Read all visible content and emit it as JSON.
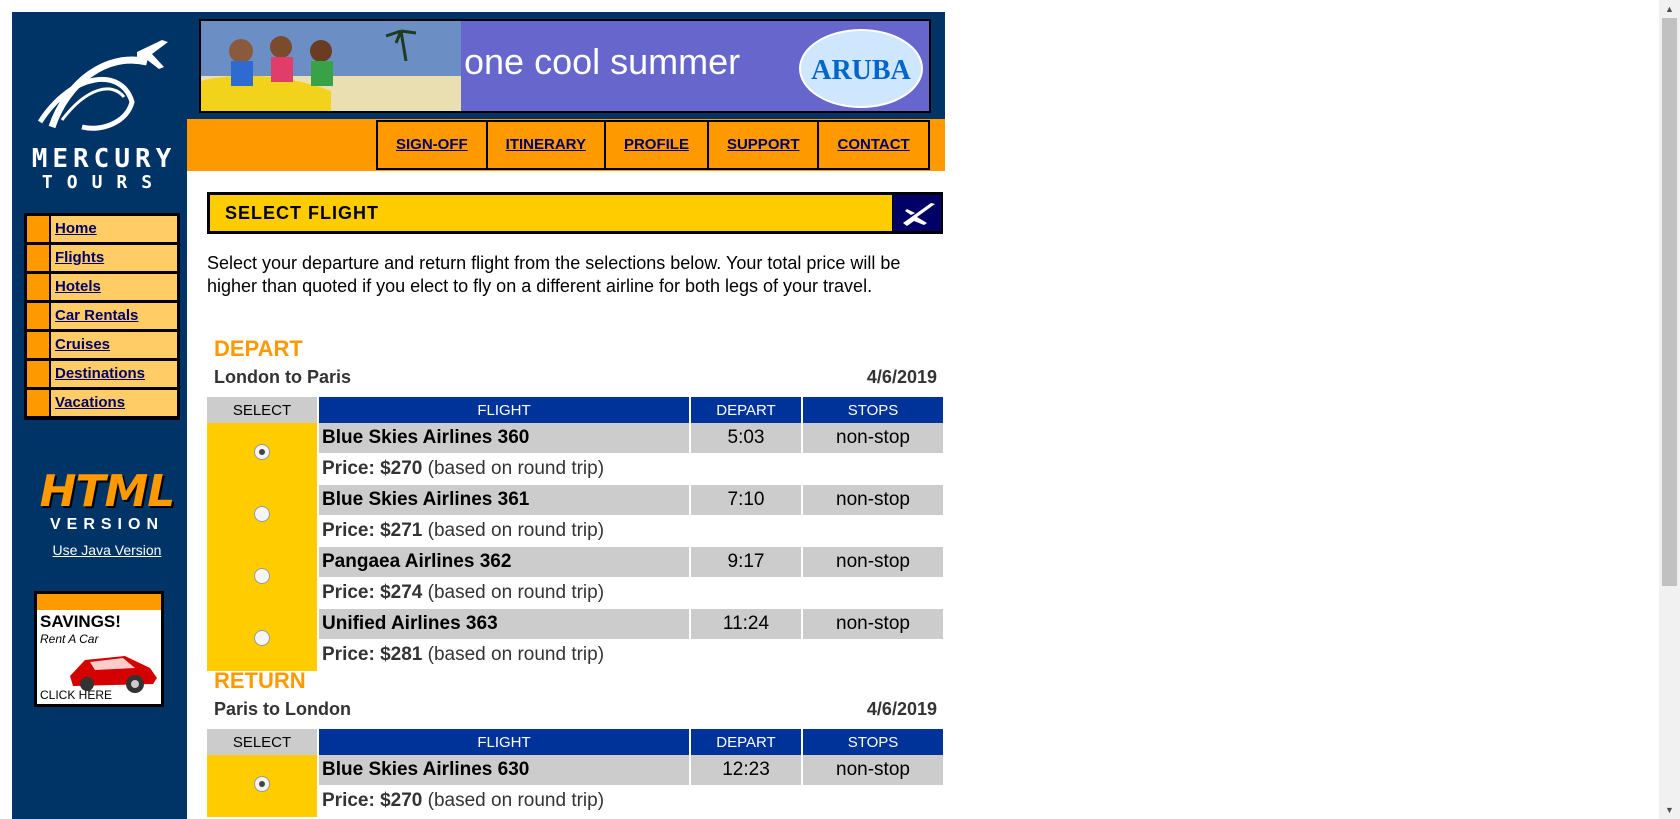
{
  "brand": {
    "line1": "MERCURY",
    "line2": "TOURS"
  },
  "sidebar": {
    "items": [
      {
        "label": "Home"
      },
      {
        "label": "Flights"
      },
      {
        "label": "Hotels"
      },
      {
        "label": "Car Rentals"
      },
      {
        "label": "Cruises"
      },
      {
        "label": "Destinations"
      },
      {
        "label": "Vacations"
      }
    ],
    "html_version": {
      "big": "HTML",
      "sub": "VERSION",
      "java_link": "Use Java Version"
    },
    "savings_ad": {
      "title": "SAVINGS!",
      "sub": "Rent A Car",
      "cta": "CLICK HERE"
    }
  },
  "banner": {
    "text": "one cool summer",
    "badge": "ARUBA"
  },
  "topnav": {
    "items": [
      {
        "label": "SIGN-OFF"
      },
      {
        "label": "ITINERARY"
      },
      {
        "label": "PROFILE"
      },
      {
        "label": "SUPPORT"
      },
      {
        "label": "CONTACT"
      }
    ]
  },
  "page_title": "SELECT FLIGHT",
  "intro": "Select your departure and return flight from the selections below. Your total price will be higher than quoted if you elect to fly on a different airline for both legs of your travel.",
  "table_headers": {
    "select": "SELECT",
    "flight": "FLIGHT",
    "depart": "DEPART",
    "stops": "STOPS"
  },
  "price_label": "Price:",
  "price_note": "(based on round trip)",
  "depart": {
    "heading": "DEPART",
    "route": "London to Paris",
    "date": "4/6/2019",
    "flights": [
      {
        "name": "Blue Skies Airlines 360",
        "time": "5:03",
        "stops": "non-stop",
        "price": "$270",
        "selected": true
      },
      {
        "name": "Blue Skies Airlines 361",
        "time": "7:10",
        "stops": "non-stop",
        "price": "$271",
        "selected": false
      },
      {
        "name": "Pangaea Airlines 362",
        "time": "9:17",
        "stops": "non-stop",
        "price": "$274",
        "selected": false
      },
      {
        "name": "Unified Airlines 363",
        "time": "11:24",
        "stops": "non-stop",
        "price": "$281",
        "selected": false
      }
    ]
  },
  "return": {
    "heading": "RETURN",
    "route": "Paris to London",
    "date": "4/6/2019",
    "flights": [
      {
        "name": "Blue Skies Airlines 630",
        "time": "12:23",
        "stops": "non-stop",
        "price": "$270",
        "selected": true
      }
    ]
  }
}
